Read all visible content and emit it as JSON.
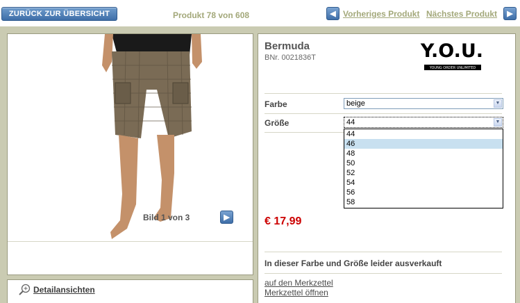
{
  "topbar": {
    "back_label": "ZURÜCK ZUR ÜBERSICHT",
    "counter": "Produkt 78 von 608",
    "prev_label": "Vorheriges Produkt",
    "next_label": "Nächstes Produkt"
  },
  "image": {
    "counter": "Bild 1 von 3",
    "detail_link": "Detailansichten"
  },
  "product": {
    "title": "Bermuda",
    "bnr": "BNr. 0021836T",
    "brand_logo": "Y.O.U.",
    "brand_tagline": "YOUNG ORDER UNLIMITED",
    "color_label": "Farbe",
    "color_value": "beige",
    "size_label": "Größe",
    "size_value": "44",
    "size_options": [
      "44",
      "46",
      "48",
      "50",
      "52",
      "54",
      "56",
      "58"
    ],
    "size_highlighted": "46",
    "price": "€ 17,99",
    "soldout_text": "In dieser Farbe und Größe leider ausverkauft",
    "wishlist_add": "auf den Merkzettel",
    "wishlist_open": "Merkzettel öffnen"
  },
  "colors": {
    "accent_blue": "#3e6ea8",
    "olive_text": "#a3a87a",
    "frame": "#cacbb2",
    "price_red": "#cc0000"
  }
}
